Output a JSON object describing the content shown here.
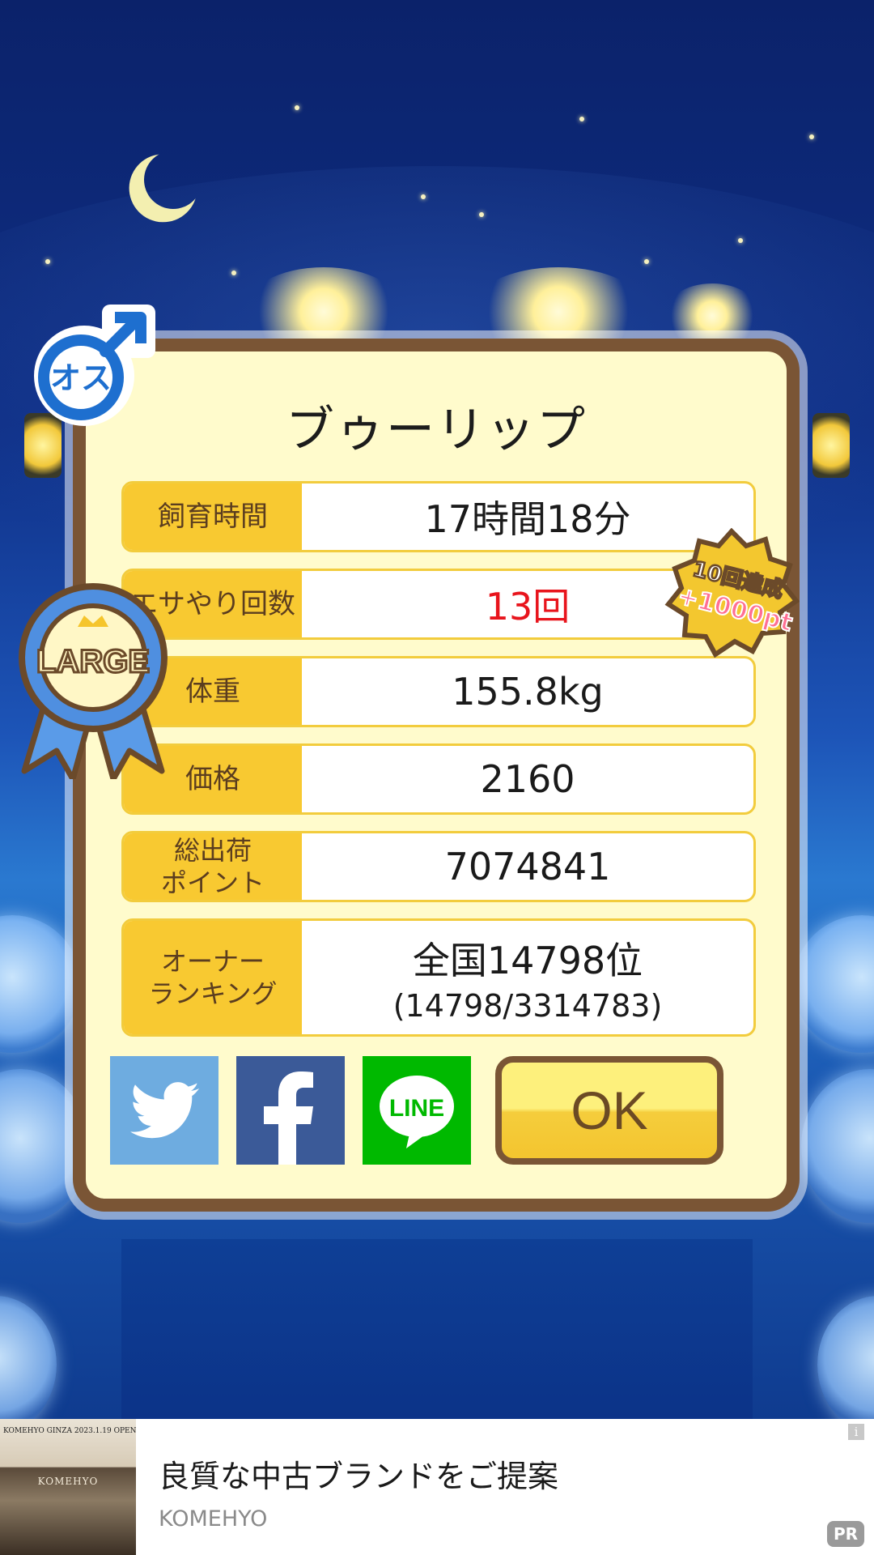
{
  "card": {
    "title": "ブゥーリップ",
    "gender_icon": "male-icon",
    "gender_label": "オス",
    "size_ribbon": "LARGE",
    "achievement_badge": "10回達成\n+1000pt",
    "rows": [
      {
        "label": "飼育時間",
        "value": "17時間18分"
      },
      {
        "label": "エサやり回数",
        "value": "13回",
        "value_color": "#e8141c"
      },
      {
        "label": "体重",
        "value": "155.8kg"
      },
      {
        "label": "価格",
        "value": "2160"
      },
      {
        "label": "総出荷\nポイント",
        "value": "7074841"
      },
      {
        "label": "オーナー\nランキング",
        "value": "全国14798位",
        "value_sub": "(14798/3314783)"
      }
    ],
    "share_buttons": [
      {
        "name": "twitter",
        "icon": "twitter-bird-icon",
        "color": "#6eace0"
      },
      {
        "name": "facebook",
        "icon": "facebook-f-icon",
        "color": "#3b5a98"
      },
      {
        "name": "line",
        "icon": "line-icon",
        "label": "LINE",
        "color": "#00b900"
      }
    ],
    "ok_label": "OK"
  },
  "ad": {
    "image_caption": "KOMEHYO GINZA 2023.1.19 OPEN",
    "image_brand": "KOMEHYO",
    "title": "良質な中古ブランドをご提案",
    "advertiser": "KOMEHYO",
    "pr_label": "PR",
    "info_icon": "i"
  }
}
